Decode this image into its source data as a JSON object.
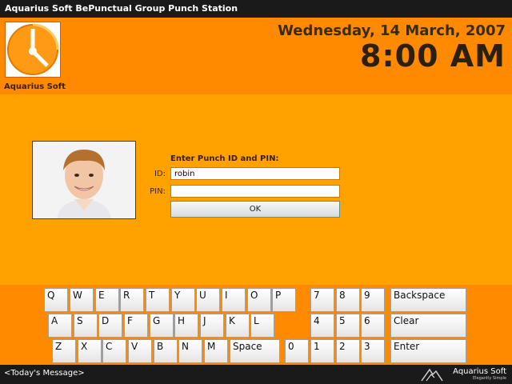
{
  "window": {
    "title": "Aquarius Soft BePunctual Group Punch Station"
  },
  "header": {
    "logo_label": "Aquarius Soft",
    "date": "Wednesday, 14 March, 2007",
    "time": "8:00 AM"
  },
  "punch_form": {
    "prompt": "Enter Punch ID and PIN:",
    "id_label": "ID:",
    "id_value": "robin",
    "pin_label": "PIN:",
    "pin_value": "",
    "ok_label": "OK"
  },
  "keyboard": {
    "row1": [
      "Q",
      "W",
      "E",
      "R",
      "T",
      "Y",
      "U",
      "I",
      "O",
      "P"
    ],
    "row2": [
      "A",
      "S",
      "D",
      "F",
      "G",
      "H",
      "J",
      "K",
      "L"
    ],
    "row3": [
      "Z",
      "X",
      "C",
      "V",
      "B",
      "N",
      "M"
    ],
    "space_label": "Space",
    "numpad": [
      "7",
      "8",
      "9",
      "4",
      "5",
      "6",
      "1",
      "2",
      "3",
      "0"
    ],
    "backspace_label": "Backspace",
    "clear_label": "Clear",
    "enter_label": "Enter"
  },
  "status": {
    "message": "<Today's Message>",
    "brand": "Aquarius Soft",
    "tagline": "Elegantly Simple"
  },
  "colors": {
    "header_orange": "#ff8a00",
    "panel_orange": "#ffa200",
    "bar_dark": "#1a1a1a"
  },
  "icons": {
    "logo": "clock-logo-icon",
    "brand": "aquarius-brand-icon"
  }
}
